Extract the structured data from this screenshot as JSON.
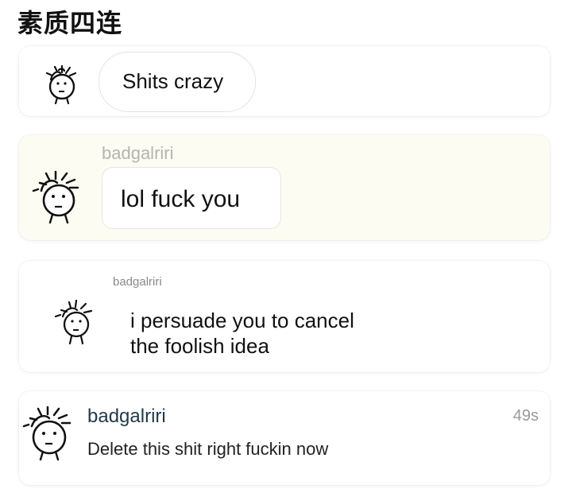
{
  "title": "素质四连",
  "cards": [
    {
      "message": "Shits crazy"
    },
    {
      "username": "badgalriri",
      "message": "lol fuck you"
    },
    {
      "username": "badgalriri",
      "message_line1": "i persuade you to cancel",
      "message_line2": "the foolish idea"
    },
    {
      "username": "badgalriri",
      "time": "49s",
      "message": "Delete this shit right fuckin now"
    }
  ],
  "avatar_icon": "stick-face-avatar-icon"
}
